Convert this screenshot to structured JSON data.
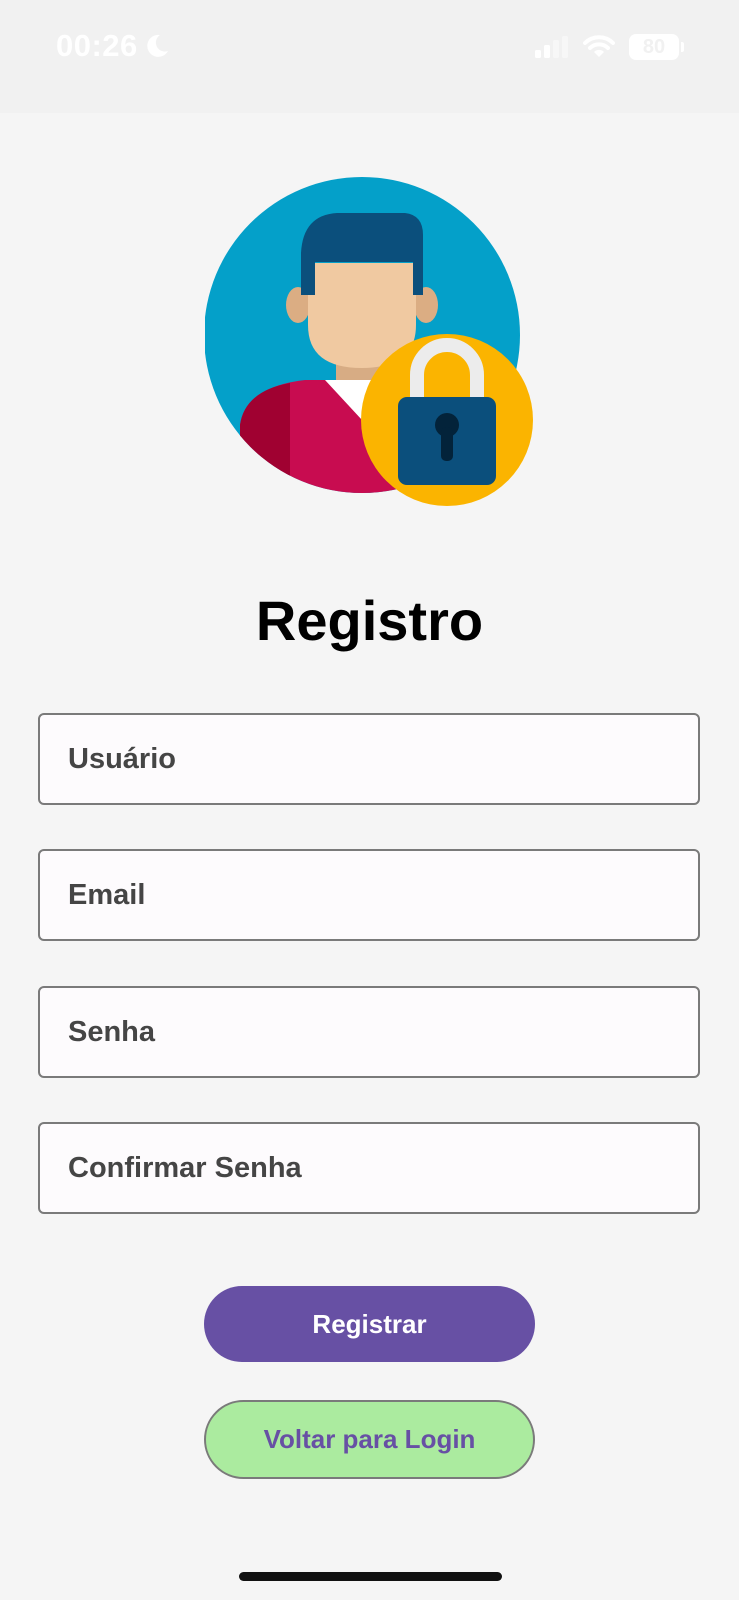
{
  "status_bar": {
    "time": "00:26",
    "battery": "80",
    "icons": [
      "moon-icon",
      "signal-icon",
      "wifi-icon",
      "battery-icon"
    ]
  },
  "avatar": {
    "icon": "user-lock-icon"
  },
  "page": {
    "title": "Registro"
  },
  "form": {
    "username_placeholder": "Usuário",
    "email_placeholder": "Email",
    "password_placeholder": "Senha",
    "confirm_password_placeholder": "Confirmar Senha"
  },
  "actions": {
    "register_label": "Registrar",
    "back_label": "Voltar para Login"
  },
  "colors": {
    "background": "#f5f5f5",
    "primary": "#6750a4",
    "secondary_button": "#abeb9f",
    "avatar_circle": "#04a0c9",
    "lock_badge": "#fbb400"
  }
}
